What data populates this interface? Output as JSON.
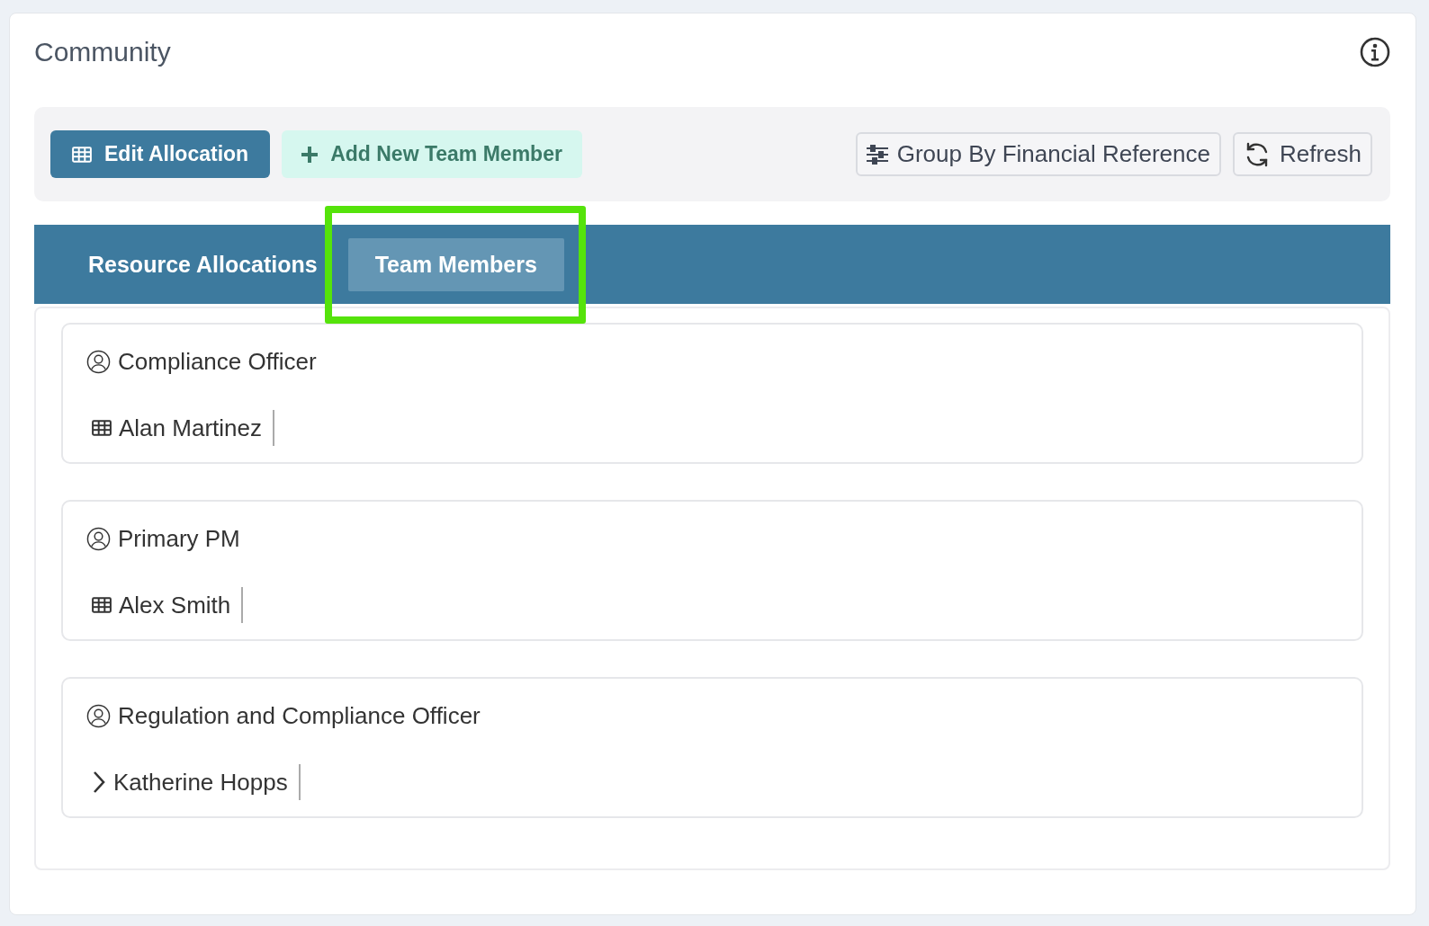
{
  "panel": {
    "title": "Community"
  },
  "toolbar": {
    "primary_button": "Edit Allocation",
    "add_button": "Add New Team Member",
    "group_button": "Group By Financial Reference",
    "refresh_button": "Refresh"
  },
  "tabs": [
    {
      "label": "Resource Allocations",
      "selected": false,
      "highlighted": false
    },
    {
      "label": "Team Members",
      "selected": true,
      "highlighted": true
    }
  ],
  "roles": [
    {
      "role": "Compliance Officer",
      "member": "Alan Martinez",
      "kind": "table"
    },
    {
      "role": "Primary PM",
      "member": "Alex Smith",
      "kind": "table"
    },
    {
      "role": "Regulation and Compliance Officer",
      "member": "Katherine Hopps",
      "kind": "expandable"
    }
  ]
}
